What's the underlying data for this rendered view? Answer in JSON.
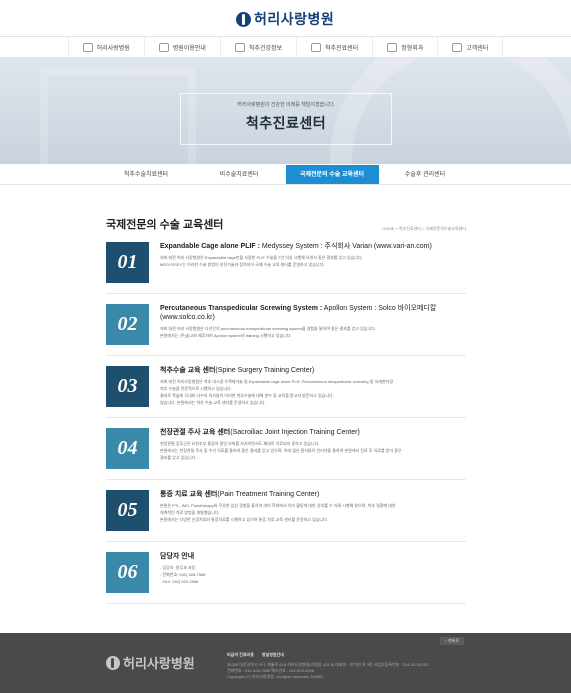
{
  "header": {
    "logo_text": "허리사랑병원"
  },
  "gnb": [
    {
      "label": "허리사랑병원",
      "icon": "hospital-icon"
    },
    {
      "label": "병원이용안내",
      "icon": "guide-icon"
    },
    {
      "label": "척추건강정보",
      "icon": "info-icon"
    },
    {
      "label": "척추진료센터",
      "icon": "spine-icon"
    },
    {
      "label": "정형외과",
      "icon": "bone-icon"
    },
    {
      "label": "고객센터",
      "icon": "support-icon"
    }
  ],
  "hero": {
    "subtitle": "허리사랑병원이 건강한 미래를 책임지겠습니다.",
    "title": "척추진료센터"
  },
  "tabs": [
    {
      "label": "척추수술치료센터",
      "active": false
    },
    {
      "label": "비수술치료센터",
      "active": false
    },
    {
      "label": "국제전문의 수술 교육센터",
      "active": true
    },
    {
      "label": "수술후 관리센터",
      "active": false
    }
  ],
  "page": {
    "title": "국제전문의 수술 교육센터",
    "breadcrumb": "HOME > 척추진료센터 > 국제전문의수술교육센터"
  },
  "items": [
    {
      "number": "01",
      "title_bold": "Expandable Cage alone PLIF :",
      "title_rest": " Medyssey System : 주식회사 Varian (www.vari-an.com)",
      "lines": [
        "저희 대전 허리 사랑병원은 Expandable cage만을 사용한 PLIF 수술을 7년 이상 시행해 오면서 좋은 결과를 얻고 있습니다.",
        "MEDYSSEY는 이러한 수술 방법이 선진기술과 접목되어 국제 수술 교육 센터를 운영하고 있습니다."
      ]
    },
    {
      "number": "02",
      "title_bold": "Percutaneous Transpedicular Screwing System :",
      "title_rest": " Apollon System : Solco 바이오메디칼 (www.solco.co.kr)",
      "lines": [
        "저희 대전 허리 사랑병원은 다년간의 percutaneous transpedicular screwing system을 경험을 통하여 좋은 결과를 얻고 있습니다.",
        "본원에서는 (주)솔고와 제휴하여 Apollon system의 training 시행하고 있습니다."
      ]
    },
    {
      "number": "03",
      "title_bold": "척추수술 교육 센터",
      "title_rest": "(Spine Surgery Training Center)",
      "lines": [
        "저희 대전 허리사랑병원은 척추 내시경 수핵제거술 및 Expandable cage alone PLIF, Percutaneous ranspedicular screwing 및 미세현미경",
        "척추 수술을 전문적으로 시행하고 있습니다.",
        "결과로 폭넓게 국내외 다수의 의사들이 이러한 척추수술에 대해 연수 및 교육을 받고자 방문하고 있습니다.",
        "있습니다. 본원에서는 척추 수술 교육 센터를 운영하고 있습니다."
      ]
    },
    {
      "number": "04",
      "title_bold": "천장관절 주사 교육 센터",
      "title_rest": "(Sacroiliac Joint Injection Training Center)",
      "lines": [
        "천장관절 증후군은 요천추부 통증의 원인 부위를 차지하면서도 제대로 치료되지 못하고 있습니다.",
        "본원에서는 천장관절 주사 및 수기 치료를 통하여 좋은 결과를 얻고 있으며, 이에 많은 환자들이 인터넷을 통하여 본원에서 진료 후 치료를 받아 좋은",
        "결과를 얻고 있습니다."
      ]
    },
    {
      "number": "05",
      "title_bold": "통증 치료 교육 센터",
      "title_rest": "(Pain Treatment Training Center)",
      "lines": [
        "본원은 PTL, IMS, Prolotherapy와 꾸준한 임상 경험을 통하여 여러 학회에서 이미 활동에 대한 강의를 수 차례 시행해 왔으며, 척추 질환에 대한",
        "체계적인 치료 방법을 개발했습니다.",
        "본원에서는 다양한 신경치료와 통증치료를 시행하고 있으며 통증 치료 교육 센터를 운영하고 있습니다."
      ]
    },
    {
      "number": "06",
      "title_bold": "담당자 안내",
      "title_rest": "",
      "lines": [
        "- 담당자: 원무과 과장",
        "- 전화번호: 042) 528-7588",
        "- FAX: 042) 529-2588"
      ]
    }
  ],
  "footer": {
    "top_button": "↑ 맨위로",
    "logo_text": "허리사랑병원",
    "links": [
      "비급여 진료비용",
      "병실병원안내"
    ],
    "lines": [
      "35265 대전광역시 서구 계룡로 618 허리사랑병원(괴정동 423-5)   대표자 : 한기현 외 3명   사업자등록번호 : 314-92-18763",
      "전화번호 : 042-528-7588    팩스번호 : 042-523-2608",
      "Copyright (C) 허리사랑병원. All rights reserved.    ADMIN"
    ]
  }
}
